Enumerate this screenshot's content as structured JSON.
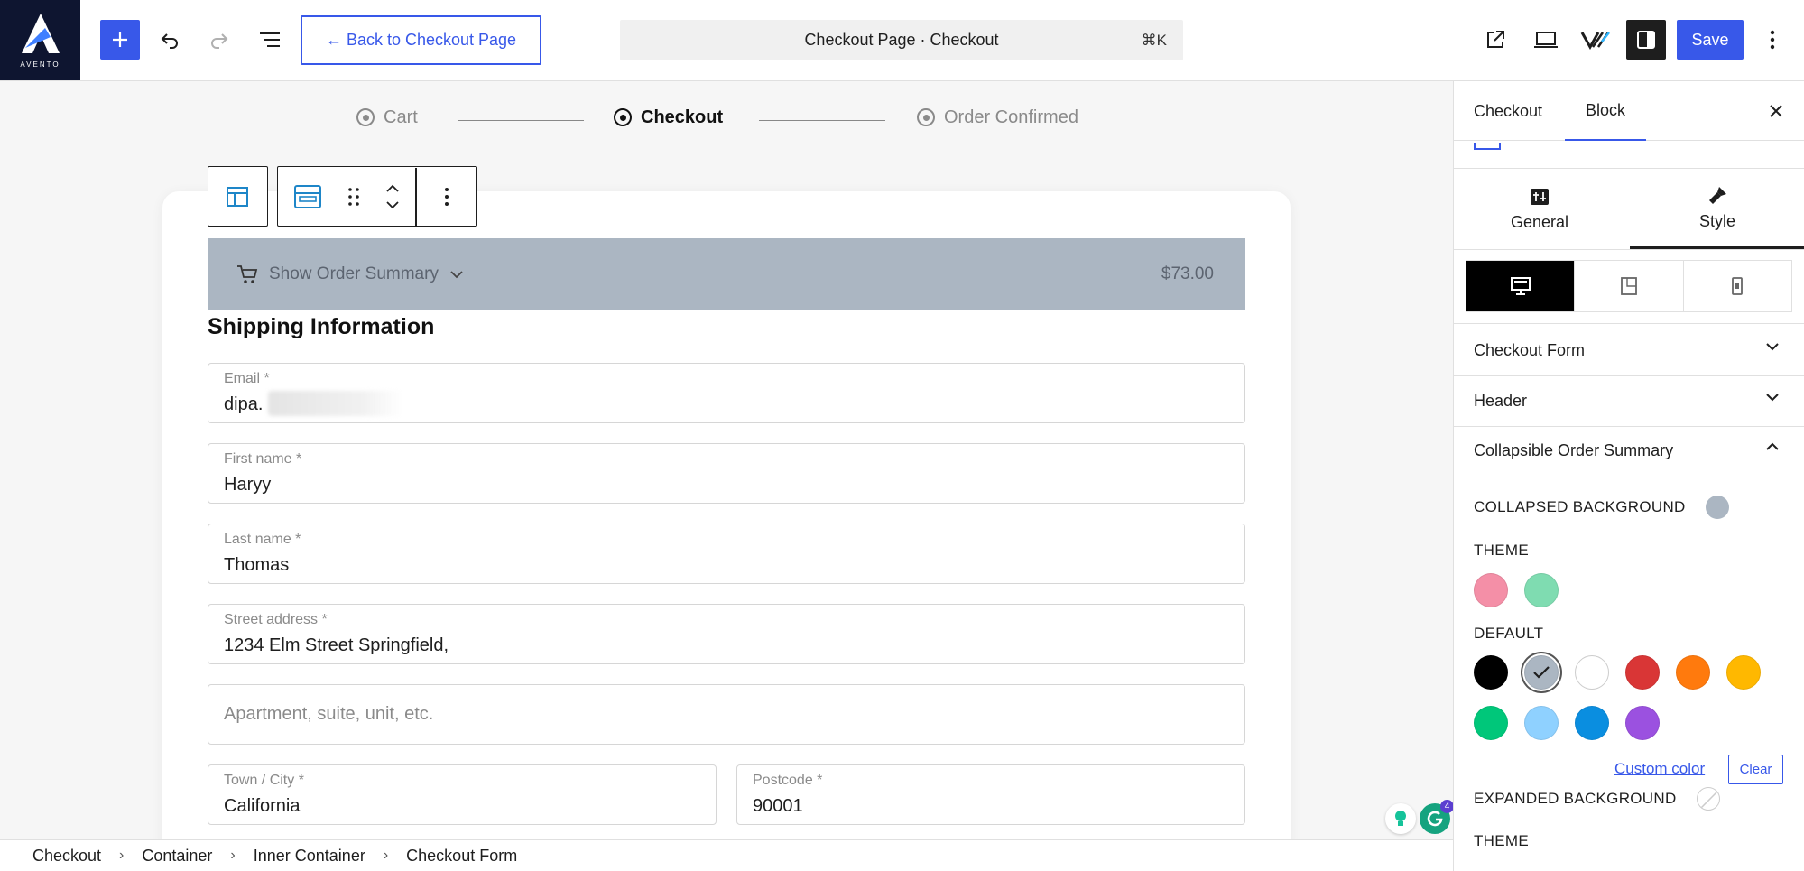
{
  "logo": {
    "text": "AVENTO"
  },
  "toolbar": {
    "back_label": "← Back to Checkout Page",
    "command_title": "Checkout Page · Checkout",
    "command_shortcut": "⌘K",
    "save_label": "Save"
  },
  "steps": [
    {
      "label": "Cart",
      "active": false
    },
    {
      "label": "Checkout",
      "active": true
    },
    {
      "label": "Order Confirmed",
      "active": false
    }
  ],
  "order_summary": {
    "label": "Show Order Summary",
    "price": "$73.00",
    "background": "#abb6c2"
  },
  "shipping": {
    "title": "Shipping Information",
    "email": {
      "label": "Email *",
      "value": "dipa."
    },
    "first_name": {
      "label": "First name *",
      "value": "Haryy"
    },
    "last_name": {
      "label": "Last name *",
      "value": "Thomas"
    },
    "street": {
      "label": "Street address *",
      "value": "1234 Elm Street Springfield,"
    },
    "apartment": {
      "placeholder": "Apartment, suite, unit, etc."
    },
    "city": {
      "label": "Town / City *",
      "value": "California"
    },
    "postcode": {
      "label": "Postcode *",
      "value": "90001"
    }
  },
  "grammarly_badge": "4",
  "breadcrumbs": [
    "Checkout",
    "Container",
    "Inner Container",
    "Checkout Form"
  ],
  "sidebar": {
    "tabs": [
      {
        "label": "Checkout",
        "active": false
      },
      {
        "label": "Block",
        "active": true
      }
    ],
    "subtabs": [
      {
        "label": "General",
        "active": false
      },
      {
        "label": "Style",
        "active": true
      }
    ],
    "panels": [
      {
        "label": "Checkout Form",
        "open": false
      },
      {
        "label": "Header",
        "open": false
      },
      {
        "label": "Collapsible Order Summary",
        "open": true
      }
    ],
    "collapsed_background": {
      "label": "COLLAPSED BACKGROUND",
      "color": "#abb6c2"
    },
    "theme_label": "THEME",
    "theme_colors": [
      "#f48fa7",
      "#7fdcb1"
    ],
    "default_label": "DEFAULT",
    "default_colors": [
      "#000000",
      "#abb6c2",
      "#ffffff",
      "#d93636",
      "#ff7a0d",
      "#ffb800",
      "#00c77a",
      "#8fd1ff",
      "#0a8ee0",
      "#9b51e0"
    ],
    "selected_default_color": "#abb6c2",
    "custom_color_label": "Custom color",
    "clear_label": "Clear",
    "expanded_background_label": "EXPANDED BACKGROUND",
    "theme_label_2": "THEME"
  },
  "colors": {
    "accent": "#3858e9",
    "dark": "#1e1e1e"
  },
  "icons": [
    "plus-icon",
    "undo-icon",
    "redo-icon",
    "list-view-icon",
    "external-link-icon",
    "laptop-icon",
    "brand-v-icon",
    "sidebar-icon",
    "more-vertical-icon",
    "close-icon",
    "cart-icon",
    "chevron-down-icon",
    "chevron-up-icon",
    "table-icon",
    "checkout-form-icon",
    "drag-handle-icon",
    "move-up-down-icon",
    "desktop-icon",
    "tablet-icon",
    "mobile-icon",
    "general-settings-icon",
    "style-brush-icon",
    "grammarly-icon",
    "idea-bulb-icon"
  ]
}
